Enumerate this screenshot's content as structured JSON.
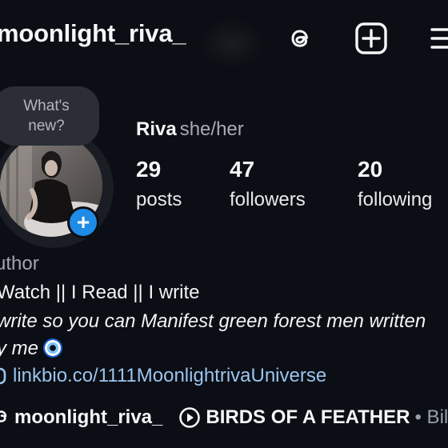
{
  "header": {
    "username": "moonlight_riva_",
    "icons": [
      "threads-icon",
      "add-post-icon",
      "menu-icon"
    ]
  },
  "note_bubble": {
    "text": "What's new?"
  },
  "profile": {
    "name": "Riva",
    "pronouns": "she/her"
  },
  "stats": [
    {
      "value": "29",
      "label": "posts"
    },
    {
      "value": "47",
      "label": "followers"
    },
    {
      "value": "20",
      "label": "following"
    }
  ],
  "bio": {
    "category": "uthor",
    "line1": "Watch || I Read || I write",
    "line2": "write so you can Manifest green forest men written",
    "line3": "y me",
    "link": "linkbio.co/1111MoonlightrivaUniverse"
  },
  "footer": {
    "threads_username": "moonlight_riva_",
    "music_title": "BIRDS OF A FEATHER",
    "music_artist": "• Bill"
  },
  "colors": {
    "background": "#0b0e14",
    "accent_blue": "#1e8be6",
    "link": "#9bc4ee",
    "muted": "#a8abb2"
  }
}
